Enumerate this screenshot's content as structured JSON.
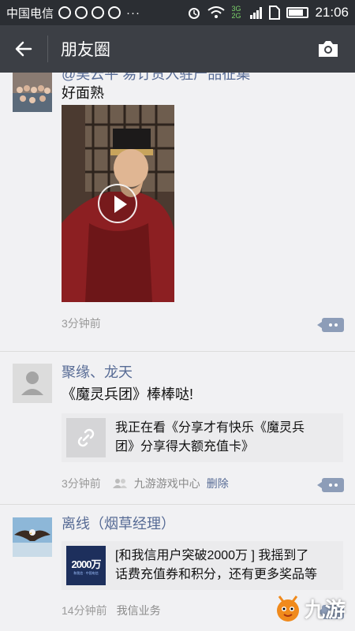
{
  "status_bar": {
    "carrier": "中国电信",
    "network": "3G 2G",
    "time": "21:06",
    "battery_level": 0.75
  },
  "header": {
    "title": "朋友圈",
    "back_icon": "back-arrow-icon",
    "camera_icon": "camera-icon"
  },
  "posts": [
    {
      "name": "@吴云平 易订货入驻产品征集",
      "text": "好面熟",
      "has_video": true,
      "time": "3分钟前"
    },
    {
      "name": "聚缘、龙天",
      "text": "《魔灵兵团》棒棒哒!",
      "share": {
        "line1": "我正在看《分享才有快乐《魔灵兵",
        "line2": "团》分享得大额充值卡》",
        "thumb_icon": "link-icon"
      },
      "time": "3分钟前",
      "source": "九游游戏中心",
      "delete_label": "删除"
    },
    {
      "name": "离线（烟草经理）",
      "share": {
        "line1": "[和我信用户突破2000万 ] 我摇到了",
        "line2": "话费充值券和积分，还有更多奖品等",
        "thumb_text": "2000万",
        "thumb_sub": "和我信 · 中国电信"
      },
      "time": "14分钟前",
      "source": "我信业务"
    }
  ],
  "watermark": {
    "text": "九游"
  },
  "colors": {
    "name": "#576b95",
    "header_bg": "#3c3f45",
    "status_bg": "#2b2e33",
    "page_bg": "#f1f1f3"
  }
}
